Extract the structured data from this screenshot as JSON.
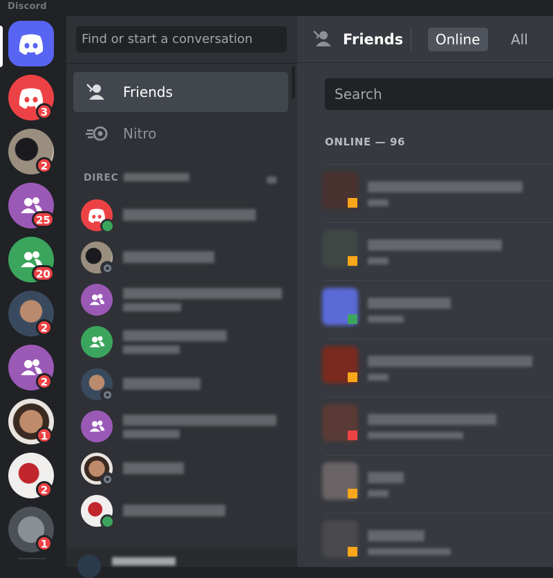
{
  "app": {
    "title": "Discord"
  },
  "colors": {
    "blurple": "#5865f2",
    "red": "#ed4245",
    "green": "#3ba55d",
    "idle": "#faa61a",
    "purple": "#9b59b6"
  },
  "servers": [
    {
      "name": "home",
      "icon": "discord-logo-icon",
      "badge": ""
    },
    {
      "name": "server-1",
      "icon": "discord-logo-icon",
      "badge": "3"
    },
    {
      "name": "server-2",
      "icon": "image-avatar",
      "badge": "2"
    },
    {
      "name": "server-3",
      "icon": "group-icon",
      "badge": "25"
    },
    {
      "name": "server-4",
      "icon": "group-icon",
      "badge": "20"
    },
    {
      "name": "server-5",
      "icon": "image-avatar",
      "badge": "2"
    },
    {
      "name": "server-6",
      "icon": "group-icon",
      "badge": "2"
    },
    {
      "name": "server-7",
      "icon": "image-avatar",
      "badge": "1"
    },
    {
      "name": "server-8",
      "icon": "image-avatar",
      "badge": "2"
    },
    {
      "name": "server-9",
      "icon": "image-avatar",
      "badge": "1"
    }
  ],
  "sidebar": {
    "search_placeholder": "Find or start a conversation",
    "nav": [
      {
        "label": "Friends",
        "icon": "friends-icon",
        "active": true
      },
      {
        "label": "Nitro",
        "icon": "nitro-icon",
        "active": false
      }
    ],
    "dm_header": "DIREC",
    "dms": [
      {
        "avatar": "discord-logo-icon",
        "status": "online"
      },
      {
        "avatar": "image-avatar",
        "status": "offline"
      },
      {
        "avatar": "group-icon",
        "status": ""
      },
      {
        "avatar": "group-icon",
        "status": ""
      },
      {
        "avatar": "image-avatar",
        "status": "offline"
      },
      {
        "avatar": "group-icon",
        "status": ""
      },
      {
        "avatar": "image-avatar",
        "status": "offline"
      },
      {
        "avatar": "image-avatar",
        "status": "online"
      }
    ]
  },
  "main": {
    "header_title": "Friends",
    "tabs": [
      {
        "label": "Online",
        "selected": true
      },
      {
        "label": "All",
        "selected": false
      }
    ],
    "search_placeholder": "Search",
    "online_label": "ONLINE — 96"
  }
}
